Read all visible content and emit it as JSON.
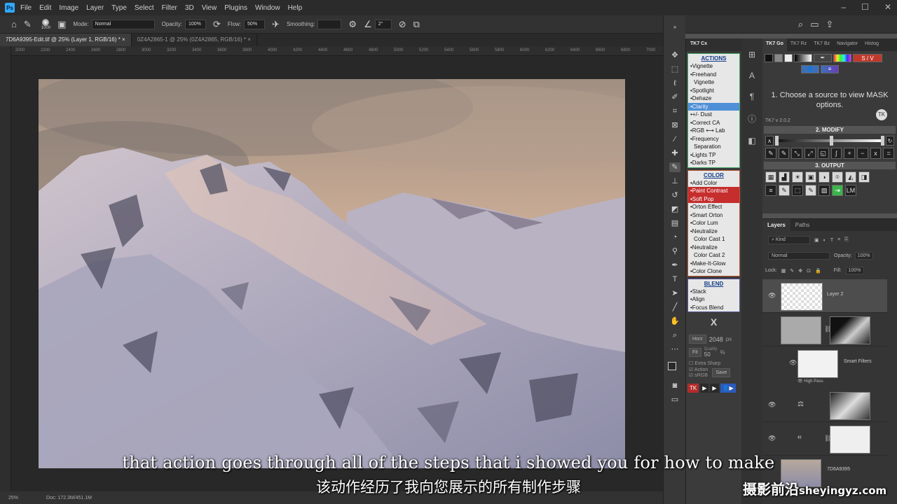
{
  "menu": {
    "logo": "Ps",
    "items": [
      "File",
      "Edit",
      "Image",
      "Layer",
      "Type",
      "Select",
      "Filter",
      "3D",
      "View",
      "Plugins",
      "Window",
      "Help"
    ]
  },
  "options": {
    "brush_size": "1000",
    "mode_label": "Mode:",
    "mode_value": "Normal",
    "opacity_label": "Opacity:",
    "opacity_value": "100%",
    "flow_label": "Flow:",
    "flow_value": "50%",
    "smoothing_label": "Smoothing:",
    "smoothing_value": "",
    "angle_value": "2°"
  },
  "tabs": [
    {
      "label": "7D6A9395-Edit.tif @ 25% (Layer 1, RGB/16) *"
    },
    {
      "label": "0Z4A2865-1 @ 25% (0Z4A2865, RGB/16) *"
    }
  ],
  "ruler_top": [
    "2000",
    "2200",
    "2400",
    "2600",
    "2800",
    "3000",
    "3200",
    "3400",
    "3600",
    "3800",
    "4000",
    "4200",
    "4400",
    "4600",
    "4800",
    "5000",
    "5200",
    "5400",
    "5600",
    "5800",
    "6000",
    "6200",
    "6400",
    "6600",
    "6800",
    "7000"
  ],
  "status": {
    "zoom": "25%",
    "doc": "Doc: 172.3M/451.1M"
  },
  "cx_panel": {
    "tab": "TK7 Cx",
    "actions_title": "ACTIONS",
    "actions": [
      "•Vignette",
      "•Freehand",
      "  Vignette",
      "•Spotlight",
      "•Dehaze",
      "•Clarity",
      "•+/- Dust",
      "•Correct CA",
      "•RGB ⟷ Lab",
      "•Frequency",
      "  Separation",
      "•Lights TP",
      "•Darks TP"
    ],
    "color_title": "COLOR",
    "color": [
      "•Add Color",
      "•Paint Contrast",
      "•Soft Pop",
      "•Orton Effect",
      "•Smart Orton",
      "•Color Lum",
      "•Neutralize",
      "  Color Cast 1",
      "•Neutralize",
      "  Color Cast 2",
      "•Make-It-Glow",
      "•Color Clone"
    ],
    "blend_title": "BLEND",
    "blend": [
      "•Stack",
      "•Align",
      "•Focus Blend"
    ],
    "close": "X",
    "horz": "Horz",
    "size": "2048",
    "px": "px",
    "fit": "Fit",
    "quality_label": "Quality",
    "quality": "50",
    "pct": "%",
    "extra_sharp": "Extra Sharp",
    "action": "Action",
    "srgb": "sRGB",
    "save": "Save",
    "tk": "TK"
  },
  "go_panel": {
    "tabs": [
      "TK7 Go",
      "TK7 Rz",
      "TK7 Bz",
      "Navigator",
      "Histog"
    ],
    "sv": "S / V",
    "message": "1. Choose a source to view MASK options.",
    "version": "TK7 v 2.0.2",
    "modify": "2. MODIFY",
    "output": "3. OUTPUT",
    "lm": "LM"
  },
  "layers": {
    "tabs": [
      "Layers",
      "Paths"
    ],
    "kind": "Kind",
    "blend_mode": "Normal",
    "opacity_label": "Opacity:",
    "opacity": "100%",
    "lock_label": "Lock:",
    "fill_label": "Fill:",
    "fill": "100%",
    "layer2": "Layer 2",
    "smart_filters": "Smart Filters",
    "high_pass": "High Pass",
    "bottom_name": "7D6A9395"
  },
  "subtitles": {
    "en": "that action goes through all of the steps that i showed you for how to make",
    "cn": "该动作经历了我向您展示的所有制作步骤"
  },
  "watermark": {
    "cn": "摄影前沿",
    "url": "sheyingyz.com"
  }
}
